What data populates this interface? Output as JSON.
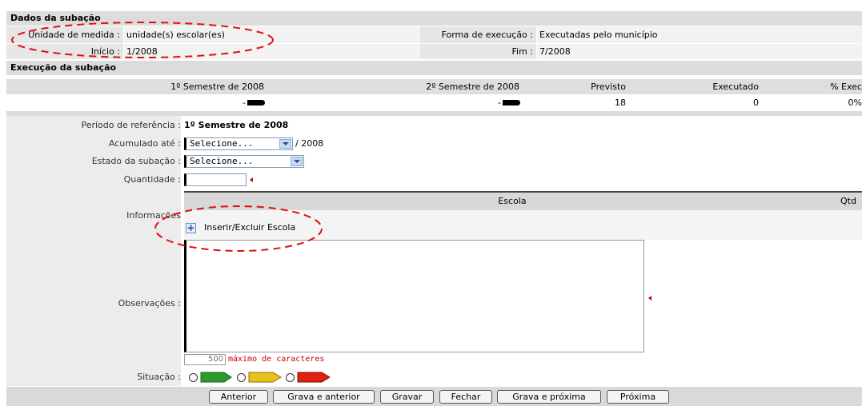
{
  "dados": {
    "title": "Dados da subação",
    "unidade_label": "Unidade de medida :",
    "unidade_value": "unidade(s) escolar(es)",
    "inicio_label": "Início :",
    "inicio_value": "1/2008",
    "forma_label": "Forma de execução :",
    "forma_value": "Executadas pelo município",
    "fim_label": "Fim :",
    "fim_value": "7/2008"
  },
  "execucao": {
    "title": "Execução da subação",
    "columns": [
      "1º Semestre de 2008",
      "2º Semestre de 2008",
      "Previsto",
      "Executado",
      "% Exec"
    ],
    "row": [
      "-",
      "-",
      "18",
      "0",
      "0%"
    ]
  },
  "form": {
    "periodo_label": "Período de referência :",
    "periodo_value": "1º Semestre de 2008",
    "acumulado_label": "Acumulado até :",
    "acumulado_select": "Selecione...",
    "acumulado_year": "/ 2008",
    "estado_label": "Estado da subação :",
    "estado_select": "Selecione...",
    "quantidade_label": "Quantidade :",
    "quantidade_value": "",
    "informacoes_label": "Informações",
    "escola_header": "Escola",
    "qtd_header": "Qtd",
    "inserir_label": "Inserir/Excluir Escola",
    "observacoes_label": "Observações :",
    "char_count": "500",
    "char_label": "máximo de caracteres",
    "situacao_label": "Situação :"
  },
  "situacao_colors": [
    "#2e9a2e",
    "#e8c21a",
    "#e02010"
  ],
  "buttons": {
    "anterior": "Anterior",
    "grava_anterior": "Grava e anterior",
    "gravar": "Gravar",
    "fechar": "Fechar",
    "grava_proxima": "Grava e próxima",
    "proxima": "Próxima"
  }
}
